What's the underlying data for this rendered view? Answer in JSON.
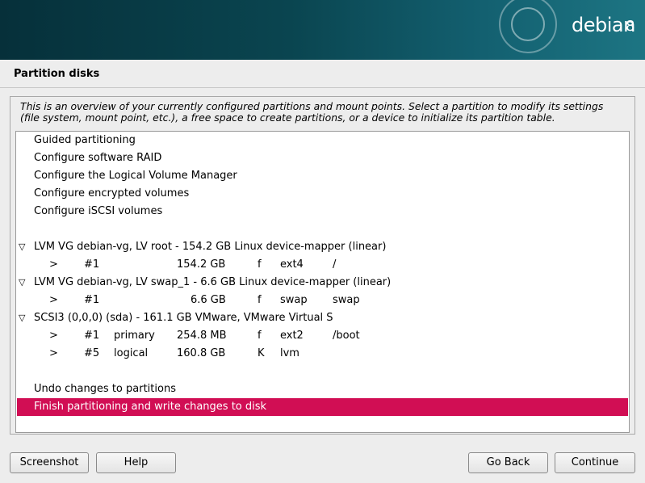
{
  "banner": {
    "logo_text": "debian",
    "logo_version": "8"
  },
  "page_title": "Partition disks",
  "description": "This is an overview of your currently configured partitions and mount points. Select a partition to modify its settings (file system, mount point, etc.), a free space to create partitions, or a device to initialize its partition table.",
  "menu": [
    "Guided partitioning",
    "Configure software RAID",
    "Configure the Logical Volume Manager",
    "Configure encrypted volumes",
    "Configure iSCSI volumes"
  ],
  "devices": [
    {
      "label": "LVM VG debian-vg, LV root - 154.2 GB Linux device-mapper (linear)",
      "partitions": [
        {
          "arrow": ">",
          "num": "#1",
          "type": "",
          "size": "154.2 GB",
          "flag": "f",
          "fs": "ext4",
          "mount": "/"
        }
      ]
    },
    {
      "label": "LVM VG debian-vg, LV swap_1 - 6.6 GB Linux device-mapper (linear)",
      "partitions": [
        {
          "arrow": ">",
          "num": "#1",
          "type": "",
          "size": "6.6 GB",
          "flag": "f",
          "fs": "swap",
          "mount": "swap"
        }
      ]
    },
    {
      "label": "SCSI3 (0,0,0) (sda) - 161.1 GB VMware, VMware Virtual S",
      "partitions": [
        {
          "arrow": ">",
          "num": "#1",
          "type": "primary",
          "size": "254.8 MB",
          "flag": "f",
          "fs": "ext2",
          "mount": "/boot"
        },
        {
          "arrow": ">",
          "num": "#5",
          "type": "logical",
          "size": "160.8 GB",
          "flag": "K",
          "fs": "lvm",
          "mount": ""
        }
      ]
    }
  ],
  "undo_label": "Undo changes to partitions",
  "finish_label": "Finish partitioning and write changes to disk",
  "buttons": {
    "screenshot": "Screenshot",
    "help": "Help",
    "go_back": "Go Back",
    "continue": "Continue"
  },
  "colors": {
    "selection": "#d10e54",
    "banner": "#0a4550"
  }
}
